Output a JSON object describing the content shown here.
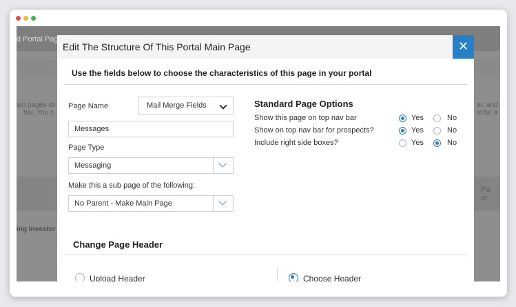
{
  "background": {
    "portal_title": "d Portal Page",
    "left_text_1": "ain pages sh",
    "left_text_2": "bar. You c",
    "right_text_1": "ar, and",
    "right_text_2": "st be a",
    "right_col_1": "Pa",
    "right_col_2": "or",
    "row_text": "ing Investor"
  },
  "modal": {
    "title": "Edit The Structure Of This Portal Main Page",
    "close_glyph": "✕",
    "subtitle": "Use the fields below to choose the characteristics of this page in your portal"
  },
  "form": {
    "page_name_label": "Page Name",
    "page_name_select": "Mail Merge Fields",
    "page_name_value": "Messages",
    "page_type_label": "Page Type",
    "page_type_value": "Messaging",
    "sub_page_label": "Make this a sub page of the following:",
    "sub_page_value": "No Parent - Make Main Page"
  },
  "standard_options": {
    "title": "Standard Page Options",
    "rows": [
      {
        "label": "Show this page on top nav bar",
        "yes": "Yes",
        "no": "No",
        "selected": "yes"
      },
      {
        "label": "Show on top nav bar for prospects?",
        "yes": "Yes",
        "no": "No",
        "selected": "yes"
      },
      {
        "label": "Include right side boxes?",
        "yes": "Yes",
        "no": "No",
        "selected": "no"
      }
    ]
  },
  "header_section": {
    "title": "Change Page Header",
    "upload_label": "Upload Header",
    "choose_label": "Choose Header",
    "selected": "choose"
  },
  "colors": {
    "accent": "#2580c8",
    "overlay": "#8e8e8e"
  }
}
